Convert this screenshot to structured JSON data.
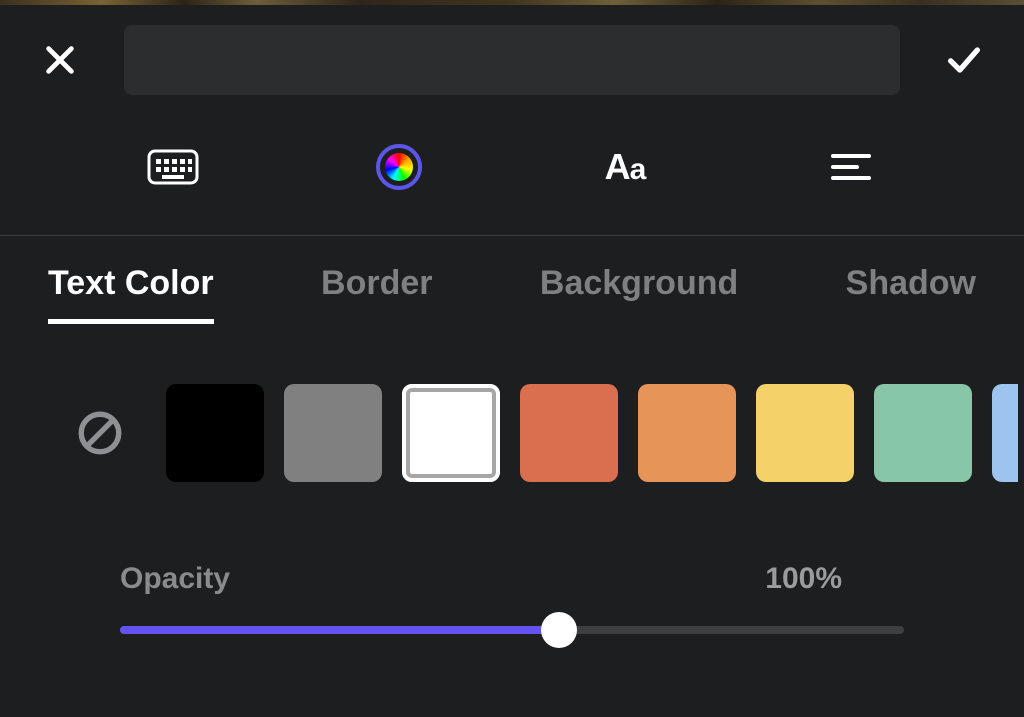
{
  "modes": {
    "keyboard_icon": "keyboard-icon",
    "color_icon": "color-wheel-icon",
    "font_label_big": "A",
    "font_label_small": "a",
    "align_icon": "align-left-icon",
    "active": "color"
  },
  "tabs": [
    {
      "id": "text-color",
      "label": "Text Color",
      "active": true
    },
    {
      "id": "border",
      "label": "Border",
      "active": false
    },
    {
      "id": "background",
      "label": "Background",
      "active": false
    },
    {
      "id": "shadow",
      "label": "Shadow",
      "active": false
    }
  ],
  "swatches": {
    "no_color_icon": "no-color-icon",
    "colors": [
      {
        "hex": "#000000",
        "selected": false
      },
      {
        "hex": "#808080",
        "selected": false
      },
      {
        "hex": "#ffffff",
        "selected": true
      },
      {
        "hex": "#d96f4f",
        "selected": false
      },
      {
        "hex": "#e79459",
        "selected": false
      },
      {
        "hex": "#f4d269",
        "selected": false
      },
      {
        "hex": "#87c7a7",
        "selected": false
      },
      {
        "hex": "#9cc4ee",
        "selected": false,
        "partial": true
      }
    ]
  },
  "opacity": {
    "label": "Opacity",
    "value_text": "100%",
    "percent": 100
  },
  "text_input": {
    "value": "",
    "placeholder": ""
  },
  "accent": "#6453f0"
}
